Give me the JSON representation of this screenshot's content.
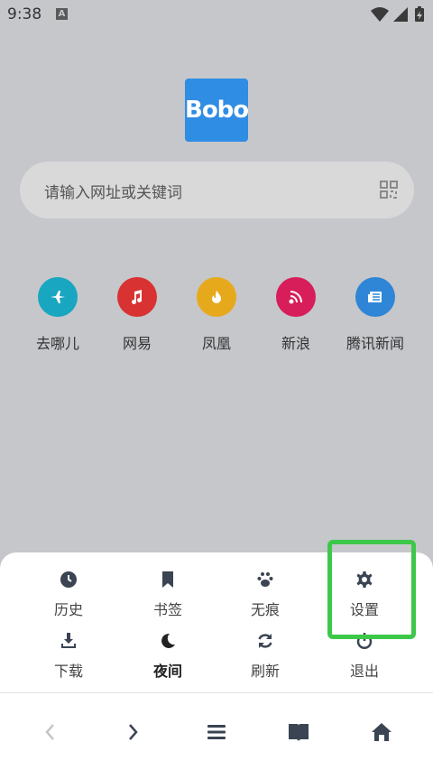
{
  "status_bar": {
    "time": "9:38",
    "notification_badge": "A"
  },
  "logo": {
    "text": "Bobo",
    "color": "#2f8de4"
  },
  "search": {
    "placeholder": "请输入网址或关键词"
  },
  "shortcuts": [
    {
      "label": "去哪儿",
      "color": "#19a6c1",
      "icon": "airplane-icon"
    },
    {
      "label": "网易",
      "color": "#d83232",
      "icon": "music-note-icon"
    },
    {
      "label": "凤凰",
      "color": "#e7a91c",
      "icon": "fire-icon"
    },
    {
      "label": "新浪",
      "color": "#d71e5a",
      "icon": "rss-icon"
    },
    {
      "label": "腾讯新闻",
      "color": "#2f86d6",
      "icon": "newspaper-icon"
    }
  ],
  "menu": {
    "row1": [
      {
        "label": "历史",
        "icon": "clock-icon"
      },
      {
        "label": "书签",
        "icon": "bookmark-icon"
      },
      {
        "label": "无痕",
        "icon": "paw-icon"
      },
      {
        "label": "设置",
        "icon": "gear-icon"
      }
    ],
    "row2": [
      {
        "label": "下载",
        "icon": "download-icon"
      },
      {
        "label": "夜间",
        "icon": "moon-icon"
      },
      {
        "label": "刷新",
        "icon": "refresh-icon"
      },
      {
        "label": "退出",
        "icon": "power-icon"
      }
    ]
  },
  "bottom_nav": [
    "back-icon",
    "forward-icon",
    "menu-icon",
    "book-icon",
    "home-icon"
  ],
  "colors": {
    "highlight": "#3dc84a",
    "icon_dark": "#3a4452"
  }
}
